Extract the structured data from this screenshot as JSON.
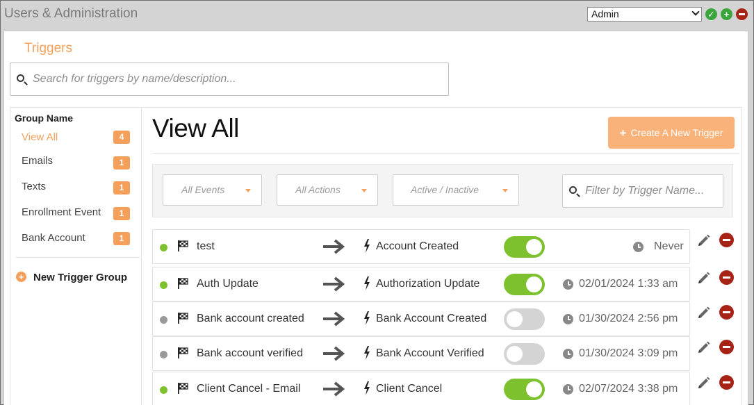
{
  "app": {
    "title": "Users & Administration"
  },
  "header": {
    "role_select": {
      "value": "Admin"
    },
    "icons": [
      {
        "name": "check-circle-icon",
        "color": "#3aa53a"
      },
      {
        "name": "add-circle-icon",
        "color": "#3aa53a"
      },
      {
        "name": "remove-circle-icon",
        "color": "#a72316"
      }
    ]
  },
  "page": {
    "section_title": "Triggers",
    "search": {
      "placeholder": "Search for triggers by name/description..."
    }
  },
  "sidebar": {
    "header": "Group Name",
    "items": [
      {
        "label": "View All",
        "count": "4",
        "active": true
      },
      {
        "label": "Emails",
        "count": "1"
      },
      {
        "label": "Texts",
        "count": "1"
      },
      {
        "label": "Enrollment Event",
        "count": "1"
      },
      {
        "label": "Bank Account",
        "count": "1"
      }
    ],
    "new_group_label": "New Trigger Group"
  },
  "main": {
    "title": "View All",
    "create_button_label": "Create A New Trigger",
    "filters": {
      "events": "All Events",
      "actions": "All Actions",
      "status": "Active / Inactive",
      "name_placeholder": "Filter by Trigger Name..."
    },
    "rows": [
      {
        "name": "test",
        "event": "Account Created",
        "active": true,
        "last_run": "Never"
      },
      {
        "name": "Auth Update",
        "event": "Authorization Update",
        "active": true,
        "last_run": "02/01/2024 1:33 am"
      },
      {
        "name": "Bank account created",
        "event": "Bank Account Created",
        "active": false,
        "last_run": "01/30/2024 2:56 pm"
      },
      {
        "name": "Bank account verified",
        "event": "Bank Account Verified",
        "active": false,
        "last_run": "01/30/2024 3:09 pm"
      },
      {
        "name": "Client Cancel - Email",
        "event": "Client Cancel",
        "active": true,
        "last_run": "02/07/2024 3:38 pm"
      }
    ]
  },
  "colors": {
    "accent": "#f5a05a",
    "button": "#f8b27a",
    "toggle_on": "#7dc22e",
    "toggle_off": "#d4d4d4",
    "status_active": "#7dc22e",
    "status_inactive": "#9a9a9a",
    "delete": "#a72316"
  }
}
